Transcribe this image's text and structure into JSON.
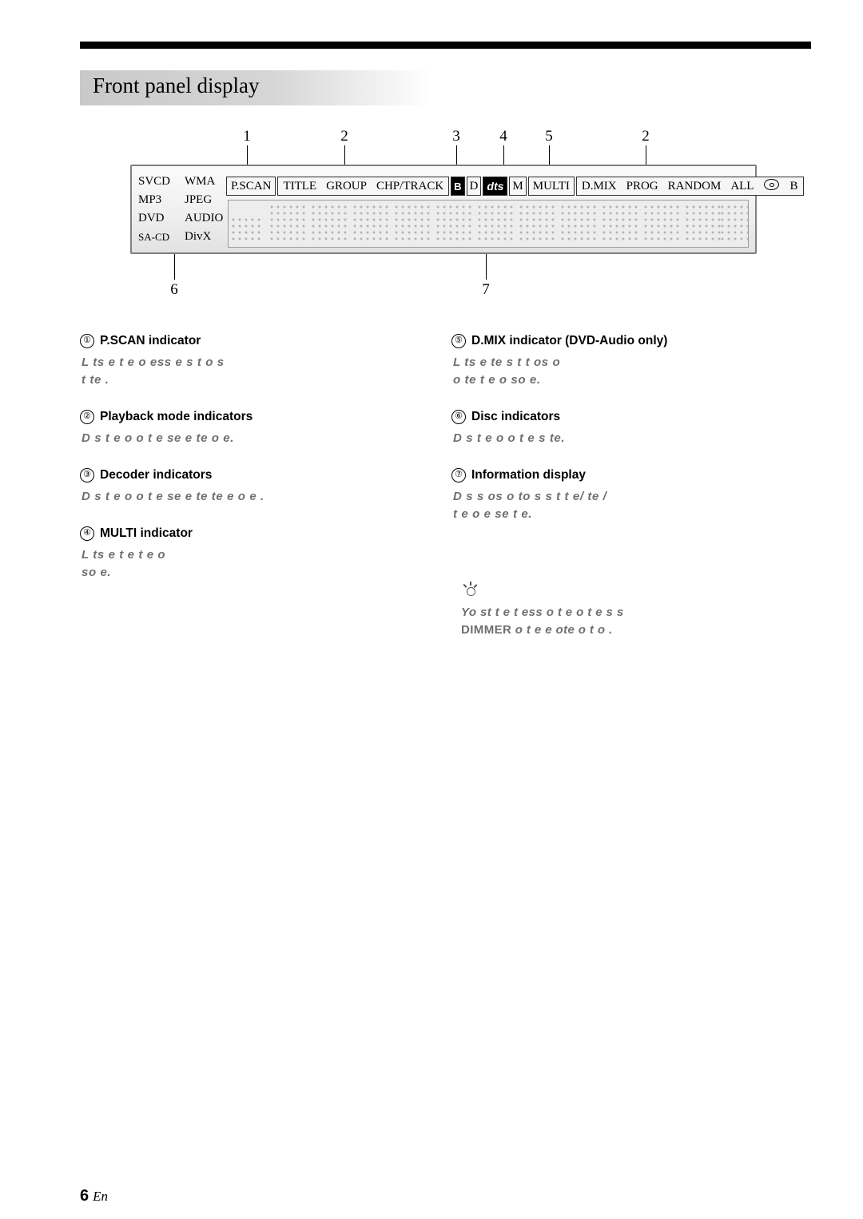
{
  "page": {
    "heading": "Front panel display",
    "footer_page": "6",
    "footer_lang": "En"
  },
  "callouts": {
    "top": [
      "1",
      "2",
      "3",
      "4",
      "5",
      "2"
    ],
    "bottom": [
      "6",
      "7"
    ]
  },
  "display_panel": {
    "disc_types": [
      [
        "SVCD",
        "WMA"
      ],
      [
        "MP3",
        "JPEG"
      ],
      [
        "DVD",
        "AUDIO"
      ],
      [
        "SA-CD",
        "DivX"
      ]
    ],
    "indicators": [
      "P.SCAN",
      "TITLE",
      "GROUP",
      "CHP/TRACK",
      "B",
      "D",
      "dts",
      "M",
      "MULTI",
      "D.MIX",
      "PROG",
      "RANDOM",
      "ALL",
      "CD",
      "B"
    ]
  },
  "items": [
    {
      "num": "①",
      "title": "P.SCAN indicator",
      "body": "L  ts  e t e  o  ess e s     t o  s\n t  te ."
    },
    {
      "num": "②",
      "title": "Playback mode indicators",
      "body": "D s   t e  o  o t e se e te      o e."
    },
    {
      "num": "③",
      "title": "Decoder indicators",
      "body": "D s   t e  o  o t e se e te  te   e o e ."
    },
    {
      "num": "④",
      "title": "MULTI indicator",
      "body": "L  ts  e    t e t   e  o\nso  e."
    },
    {
      "num": "⑤",
      "title": "D.MIX indicator (DVD-Audio only)",
      "body": "L  ts  e     te s t t   os o\n o  te t   e   o so  e."
    },
    {
      "num": "⑥",
      "title": "Disc indicators",
      "body": "D s   t e  o  o t e  s  te."
    },
    {
      "num": "⑦",
      "title": "Information display",
      "body": "D s  s  os  o  to s  s  t t e/  te /\n t   e o e  se     t e."
    }
  ],
  "note": {
    "text_before": "Yo    st t e   t ess o  t e  o t  e s  s   ",
    "keyword": "DIMMER",
    "text_after": " o  t e  e ote  o t o ."
  }
}
